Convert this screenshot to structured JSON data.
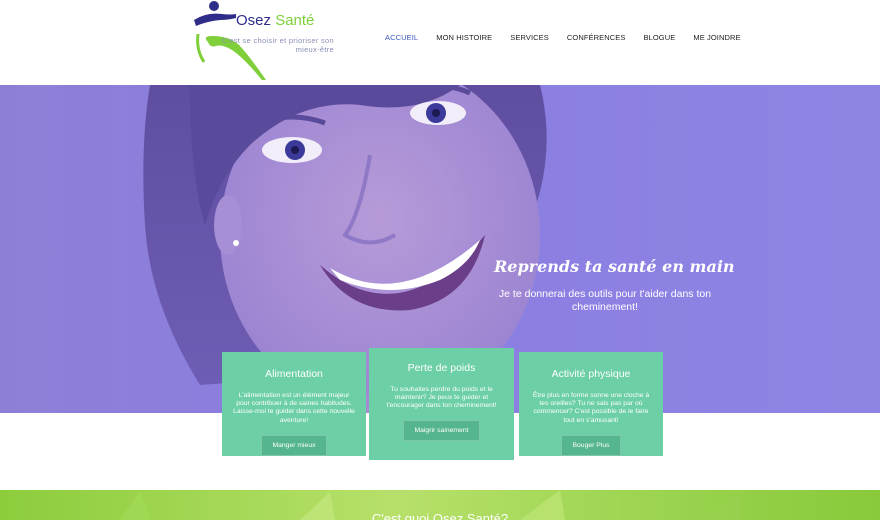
{
  "logo": {
    "title_part1": "Osez",
    "title_part2": "Santé",
    "tagline": "C'est se choisir et prioriser son mieux-être"
  },
  "nav": {
    "items": [
      "ACCUEIL",
      "MON HISTOIRE",
      "SERVICES",
      "CONFÉRENCES",
      "BLOGUE",
      "ME JOINDRE"
    ],
    "active": "ACCUEIL"
  },
  "hero": {
    "title": "Reprends ta santé en main",
    "subtitle": "Je te donnerai des outils pour t'aider dans ton cheminement!"
  },
  "cards": [
    {
      "title": "Alimentation",
      "text": "L'alimentation est un élément majeur pour contribuer à de saines habitudes. Laisse-moi te guider dans cette nouvelle aventure!",
      "button": "Manger mieux"
    },
    {
      "title": "Perte de poids",
      "text": "Tu souhaites perdre du poids et le maintenir? Je peux te guider et t'encourager dans ton cheminement!",
      "button": "Maigrir sainement"
    },
    {
      "title": "Activité physique",
      "text": "Être plus en forme sonne une cloche à tes oreilles? Tu ne sais pas par où commencer? C'est possible de le faire tout en s'amusant!",
      "button": "Bouger Plus"
    }
  ],
  "section": {
    "title": "C'est quoi Osez Santé?"
  },
  "colors": {
    "brand_navy": "#2e2d8a",
    "brand_green": "#7fcf3a",
    "hero_overlay": "#8a7ee0",
    "card_green": "#6ccfa6",
    "nav_active": "#3b5bb8"
  }
}
